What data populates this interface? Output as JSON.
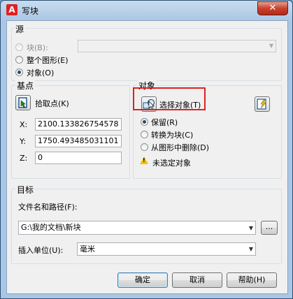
{
  "window": {
    "title": "写块",
    "close_glyph": "✕"
  },
  "source": {
    "group_label": "源",
    "options": [
      {
        "label": "块(B):",
        "selected": false,
        "enabled": false
      },
      {
        "label": "整个图形(E)",
        "selected": false,
        "enabled": true
      },
      {
        "label": "对象(O)",
        "selected": true,
        "enabled": true
      }
    ],
    "block_combo_value": ""
  },
  "base_point": {
    "group_label": "基点",
    "pick_label": "拾取点(K)",
    "x_label": "X:",
    "x_value": "2100.133826754578",
    "y_label": "Y:",
    "y_value": "1750.493485031101",
    "z_label": "Z:",
    "z_value": "0"
  },
  "objects": {
    "group_label": "对象",
    "select_label": "选择对象(T)",
    "options": [
      {
        "label": "保留(R)",
        "selected": true
      },
      {
        "label": "转换为块(C)",
        "selected": false
      },
      {
        "label": "从图形中删除(D)",
        "selected": false
      }
    ],
    "status": "未选定对象"
  },
  "target": {
    "group_label": "目标",
    "path_label": "文件名和路径(F):",
    "path_value": "G:\\我的文档\\新块",
    "browse_label": "...",
    "units_label": "插入单位(U):",
    "units_value": "毫米"
  },
  "buttons": {
    "ok": "确定",
    "cancel": "取消",
    "help": "帮助(H)"
  },
  "colors": {
    "highlight": "#e02020",
    "title_bar": "#a9c6e4"
  }
}
